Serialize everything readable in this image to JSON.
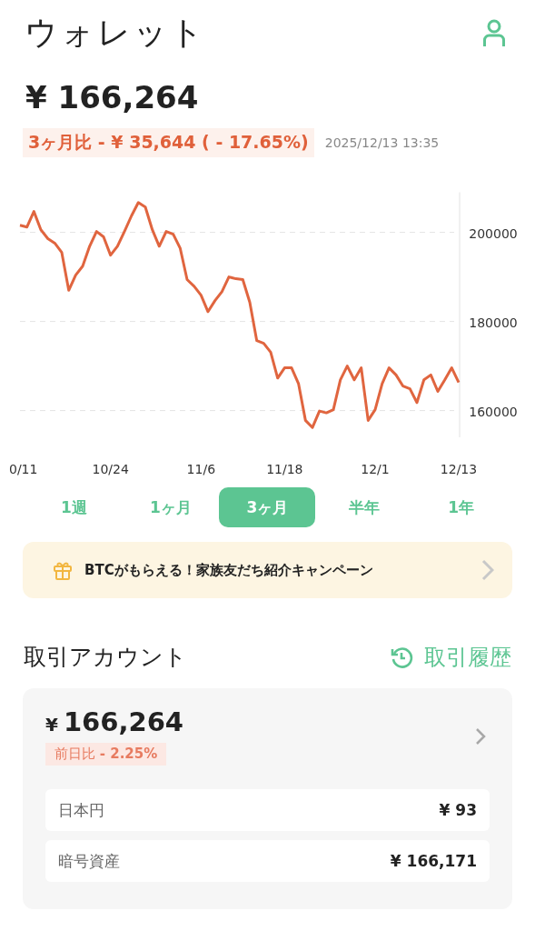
{
  "header": {
    "title": "ウォレット"
  },
  "balance": {
    "amount": "¥ 166,264",
    "change": "3ヶ月比 - ¥ 35,644 ( - 17.65%)",
    "timestamp": "2025/12/13 13:35"
  },
  "chart": {
    "chart_data": {
      "type": "line",
      "grid": true,
      "ylim": [
        154000,
        209000
      ],
      "yticks": [
        160000,
        180000,
        200000
      ],
      "categories": [
        "0/11",
        null,
        null,
        null,
        null,
        null,
        null,
        null,
        null,
        null,
        null,
        null,
        null,
        "10/24",
        null,
        null,
        null,
        null,
        null,
        null,
        null,
        null,
        null,
        null,
        null,
        null,
        "11/6",
        null,
        null,
        null,
        null,
        null,
        null,
        null,
        null,
        null,
        null,
        null,
        "11/18",
        null,
        null,
        null,
        null,
        null,
        null,
        null,
        null,
        null,
        null,
        null,
        null,
        "12/1",
        null,
        null,
        null,
        null,
        null,
        null,
        null,
        null,
        null,
        null,
        null,
        "12/13"
      ],
      "series": [
        {
          "color": "#e0653f",
          "values": [
            201600,
            201200,
            204700,
            200600,
            198600,
            197600,
            195500,
            187000,
            190400,
            192400,
            196900,
            200200,
            199000,
            194900,
            196900,
            200200,
            203700,
            206700,
            205700,
            200600,
            196900,
            200200,
            199600,
            196500,
            189400,
            187900,
            185900,
            182200,
            184700,
            186700,
            190000,
            189600,
            189400,
            184300,
            175700,
            175100,
            173100,
            167300,
            169600,
            169600,
            166000,
            157800,
            156200,
            159900,
            159500,
            160200,
            166900,
            170000,
            166900,
            169600,
            157800,
            160200,
            166000,
            169600,
            168000,
            165500,
            164900,
            161800,
            166900,
            168000,
            164300,
            166900,
            169600,
            166300
          ]
        }
      ]
    }
  },
  "periods": [
    {
      "label": "1週",
      "selected": false
    },
    {
      "label": "1ヶ月",
      "selected": false
    },
    {
      "label": "3ヶ月",
      "selected": true
    },
    {
      "label": "半年",
      "selected": false
    },
    {
      "label": "1年",
      "selected": false
    }
  ],
  "banner": {
    "text": "BTCがもらえる！家族友だち紹介キャンペーン"
  },
  "account": {
    "title": "取引アカウント",
    "history_link": "取引履歴",
    "amount_symbol": "¥",
    "amount": "166,264",
    "change_label": "前日比",
    "change_value": "- 2.25%",
    "rows": [
      {
        "label": "日本円",
        "value": "¥ 93"
      },
      {
        "label": "暗号資産",
        "value": "¥ 166,171"
      }
    ]
  }
}
